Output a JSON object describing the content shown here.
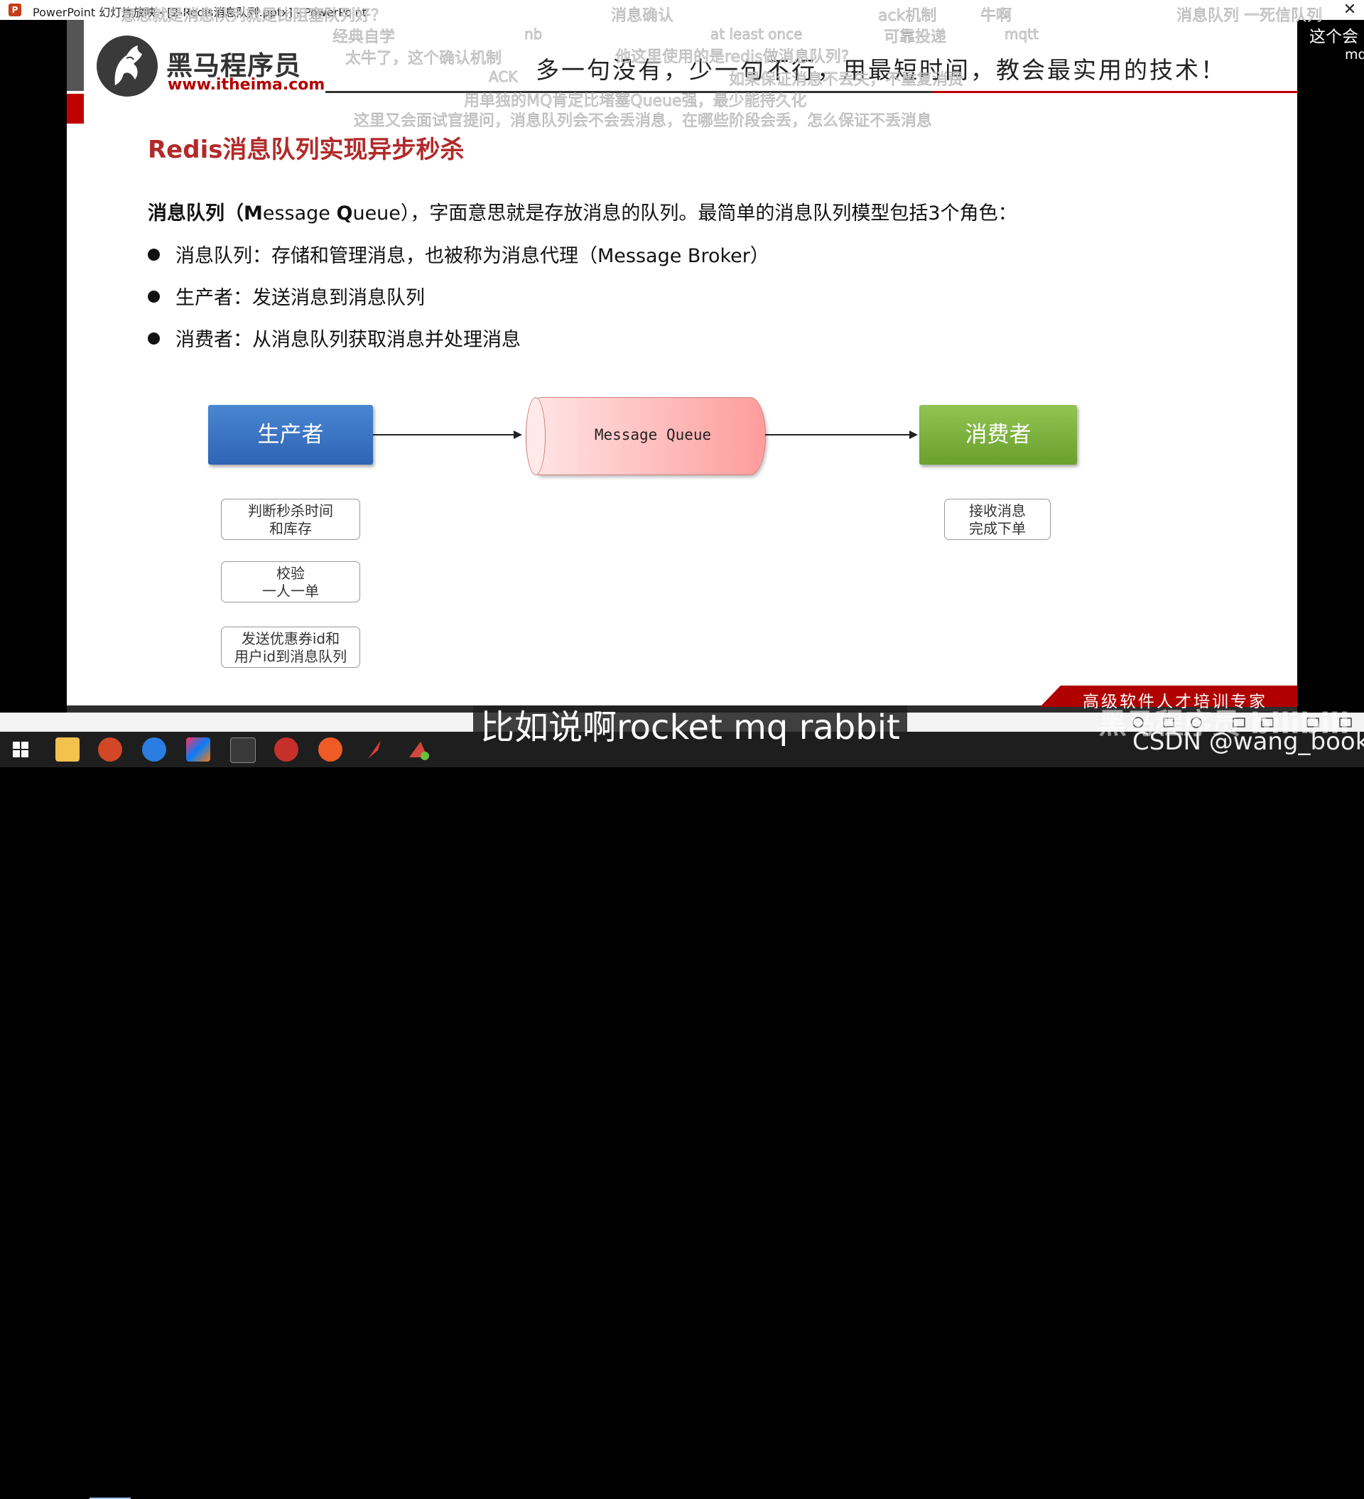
{
  "window": {
    "app_title": "PowerPoint 幻灯片放映 - [2-Redis消息队列.pptx] - PowerPoint",
    "close_glyph": "✕"
  },
  "slide": {
    "logo_name": "黑马程序员",
    "logo_url": "www.itheima.com",
    "slogan": "多一句没有，少一句不行，用最短时间，教会最实用的技术！",
    "title": "Redis消息队列实现异步秒杀",
    "intro": {
      "term_part1": "消息队列（",
      "term_M": "M",
      "term_mid": "essage ",
      "term_Q": "Q",
      "term_end": "ueue）",
      "rest": "，字面意思就是存放消息的队列。最简单的消息队列模型包括3个角色："
    },
    "bullets": [
      "消息队列：存储和管理消息，也被称为消息代理（Message Broker）",
      "生产者：发送消息到消息队列",
      "消费者：从消息队列获取消息并处理消息"
    ],
    "diagram": {
      "producer": "生产者",
      "queue": "Message Queue",
      "consumer": "消费者",
      "producer_notes": [
        [
          "判断秒杀时间",
          "和库存"
        ],
        [
          "校验",
          "一人一单"
        ],
        [
          "发送优惠券id和",
          "用户id到消息队列"
        ]
      ],
      "consumer_notes": [
        [
          "接收消息",
          "完成下单"
        ]
      ]
    },
    "banner": "高级软件人才培训专家"
  },
  "side_panel": [
    "这个会",
    "mq"
  ],
  "danmaku": [
    "意思就是消息队列就是比阻塞队列好？",
    "消息确认",
    "ack机制",
    "牛啊",
    "消息队列 一死信队列",
    "经典自学",
    "nb",
    "at least once",
    "可靠投递",
    "mqtt",
    "太牛了，这个确认机制",
    "他这里使用的是redis做消息队列?",
    "ACK",
    "如果保证消息不丢失，不重复消费",
    "用单独的MQ肯定比堵塞Queue强，最少能持久化",
    "这里又会面试官提问，消息队列会不会丢消息，在哪些阶段会丢，怎么保证不丢消息"
  ],
  "subtitle": "比如说啊rocket mq rabbit",
  "watermark": {
    "csdn": "CSDN @wang_book",
    "bilibili": "黑马程序员 bilibili"
  },
  "taskbar": {
    "icons": [
      "windows-start",
      "file-explorer",
      "powerpoint",
      "browser",
      "intellij-idea",
      "terminal",
      "redis-desktop",
      "postman",
      "feather-app",
      "jmeter"
    ]
  }
}
